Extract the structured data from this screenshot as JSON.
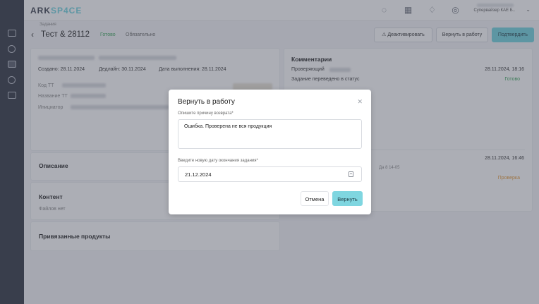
{
  "app": {
    "logo_a": "ARK",
    "logo_b": "SP4CE"
  },
  "user": {
    "role": "Супервайзер КАЕ Б.."
  },
  "header": {
    "breadcrumb": "Задания",
    "title": "Тест & 28112",
    "status": "Готово",
    "priority": "Обязательно",
    "btn_deactivate": "⚠ Деактивировать",
    "btn_return": "Вернуть в работу",
    "btn_confirm": "Подтвердить"
  },
  "task": {
    "created": "Создано: 28.11.2024",
    "deadline": "Дедлайн: 30.11.2024",
    "done": "Дата выполнения: 28.11.2024",
    "code_label": "Код ТТ",
    "name_label": "Название ТТ",
    "initiator_label": "Инициатор"
  },
  "sections": {
    "description": "Описание",
    "content": "Контент",
    "no_files": "Файлов нет",
    "products": "Привязанные продукты"
  },
  "comments": {
    "title": "Комментарии",
    "reviewer_label": "Проверяющий",
    "entry1_date": "28.11.2024, 18:16",
    "entry1_text": "Задание переведено в статус",
    "entry1_status": "Готово",
    "entry2_date": "28.11.2024, 16:46",
    "entry2_sub": "Да 8 14-05",
    "entry2_status": "Проверка"
  },
  "modal": {
    "title": "Вернуть в работу",
    "reason_label": "Опишите причину возврата*",
    "reason_value": "Ошибка. Проверена не вся продукция",
    "date_label": "Введите новую дату окончания задания*",
    "date_value": "21.12.2024",
    "cancel": "Отмена",
    "confirm": "Вернуть"
  },
  "colors": {
    "accent": "#6fd3df",
    "ready": "#3aa55a",
    "review": "#e59a3a",
    "rail": "#2f3340"
  }
}
